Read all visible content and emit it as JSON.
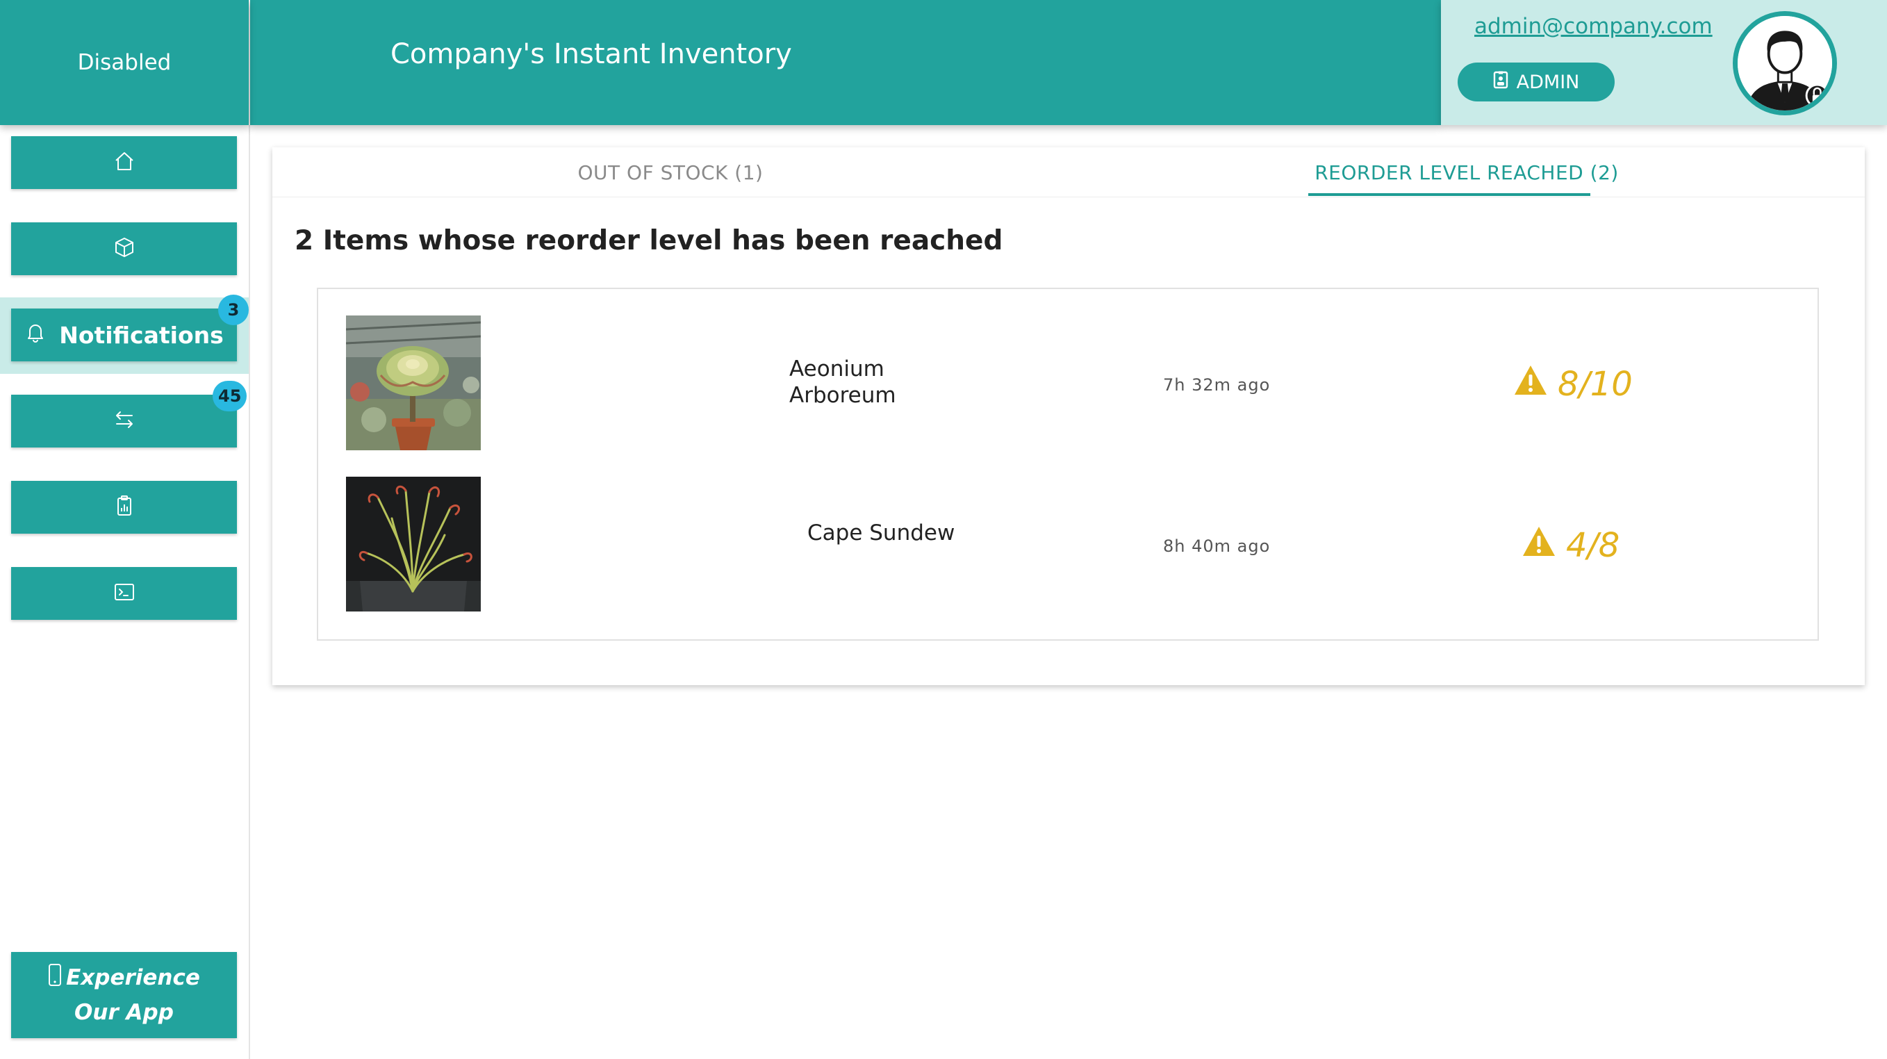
{
  "brand": {
    "status_label": "Disabled"
  },
  "header": {
    "title": "Company's Instant Inventory"
  },
  "user": {
    "email": "admin@company.com",
    "role": "ADMIN"
  },
  "sidebar": {
    "items": [
      {
        "icon": "home-icon"
      },
      {
        "icon": "box-icon"
      },
      {
        "icon": "bell-icon",
        "label": "Notifications",
        "badge": "3",
        "active": true
      },
      {
        "icon": "transfer-arrows-icon",
        "badge": "45"
      },
      {
        "icon": "report-clipboard-icon"
      },
      {
        "icon": "terminal-icon"
      }
    ],
    "promo_label": "Experience Our App"
  },
  "tabs": [
    {
      "label": "OUT OF STOCK (1)",
      "active": false
    },
    {
      "label": "REORDER LEVEL REACHED (2)",
      "active": true
    }
  ],
  "content": {
    "heading": "2 Items whose reorder level has been reached",
    "items": [
      {
        "name": "Aeonium Arboreum",
        "time": "7h 32m ago",
        "level": "8/10",
        "image": "succulent-photo"
      },
      {
        "name": "Cape Sundew",
        "time": "8h 40m ago",
        "level": "4/8",
        "image": "sundew-photo"
      }
    ]
  },
  "colors": {
    "primary": "#22a39d",
    "primary_light": "#c9ebe8",
    "badge": "#29b8e0",
    "warning": "#e3b21e"
  }
}
